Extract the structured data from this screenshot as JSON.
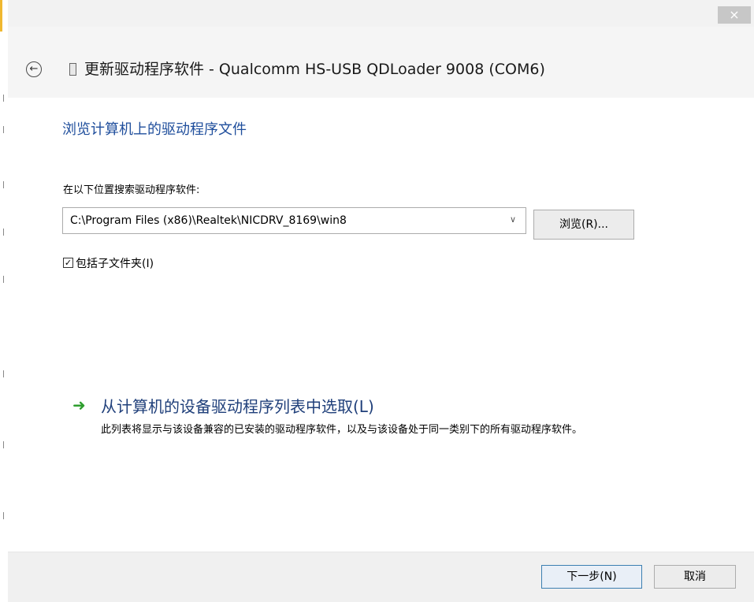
{
  "window": {
    "close_glyph": "×",
    "title": "更新驱动程序软件 - Qualcomm HS-USB QDLoader 9008 (COM6)",
    "back_icon": "back-arrow-icon",
    "device_icon": "usb-device-icon"
  },
  "main": {
    "heading": "浏览计算机上的驱动程序文件",
    "search_label": "在以下位置搜索驱动程序软件:",
    "path_value": "C:\\Program Files (x86)\\Realtek\\NICDRV_8169\\win8",
    "browse_label": "浏览(R)...",
    "include_subfolders_label": "包括子文件夹(I)",
    "include_subfolders_checked": true
  },
  "pick_option": {
    "title": "从计算机的设备驱动程序列表中选取(L)",
    "description": "此列表将显示与该设备兼容的已安装的驱动程序软件，以及与该设备处于同一类别下的所有驱动程序软件。",
    "arrow_icon": "green-arrow-icon"
  },
  "footer": {
    "next_label": "下一步(N)",
    "cancel_label": "取消"
  },
  "colors": {
    "heading": "#1f4e9c",
    "link": "#1f3f7a",
    "arrow": "#2e9e2e",
    "accent": "#f0b830"
  }
}
